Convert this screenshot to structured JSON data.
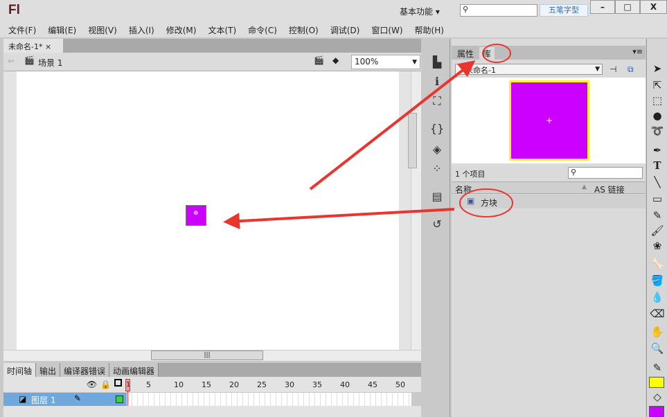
{
  "app": {
    "logo": "Fl",
    "workspace": "基本功能 ▾",
    "search_placeholder": "",
    "watermark": "五笔字型",
    "min": "–",
    "max": "□",
    "close": "X"
  },
  "menu": [
    "文件(F)",
    "编辑(E)",
    "视图(V)",
    "插入(I)",
    "修改(M)",
    "文本(T)",
    "命令(C)",
    "控制(O)",
    "调试(D)",
    "窗口(W)",
    "帮助(H)"
  ],
  "document": {
    "tab": "未命名-1*",
    "tab_close": "×",
    "scene": "场景 1",
    "zoom": "100%"
  },
  "stage": {
    "symbol_color": "#cc00ff"
  },
  "timeline": {
    "tabs": [
      "时间轴",
      "输出",
      "编译器错误",
      "动画编辑器"
    ],
    "frame_numbers": [
      "1",
      "5",
      "10",
      "15",
      "20",
      "25",
      "30",
      "35",
      "40",
      "45",
      "50"
    ],
    "layer": "图层 1"
  },
  "library": {
    "tabs": [
      "属性",
      "库"
    ],
    "document": "未命名-1",
    "count": "1 个项目",
    "col_name": "名称",
    "col_linkage": "AS 链接",
    "items": [
      {
        "name": "方块"
      }
    ],
    "preview_fill": "#cc00ff",
    "preview_stroke": "#ffee33"
  },
  "tools": {
    "stroke_color": "#ffff00",
    "fill_color": "#cc00ff"
  },
  "annotation": {
    "color": "#e8362e"
  }
}
